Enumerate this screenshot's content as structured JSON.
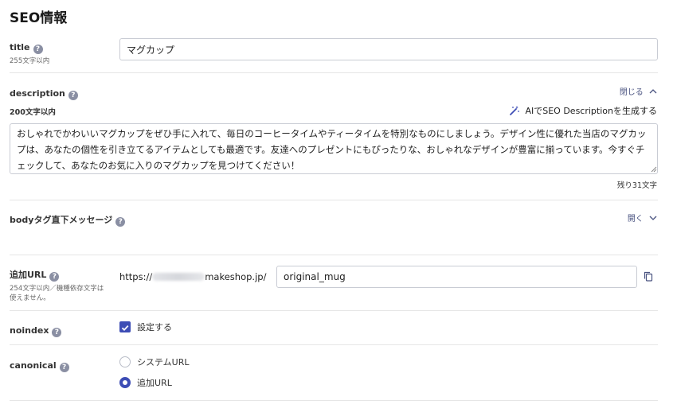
{
  "page": {
    "title": "SEO情報"
  },
  "title_field": {
    "label": "title",
    "limit": "255文字以内",
    "value": "マグカップ"
  },
  "description": {
    "label": "description",
    "toggle": "閉じる",
    "limit": "200文字以内",
    "ai_link": "AIでSEO Descriptionを生成する",
    "value": "おしゃれでかわいいマグカップをぜひ手に入れて、毎日のコーヒータイムやティータイムを特別なものにしましょう。デザイン性に優れた当店のマグカップは、あなたの個性を引き立てるアイテムとしても最適です。友達へのプレゼントにもぴったりな、おしゃれなデザインが豊富に揃っています。今すぐチェックして、あなたのお気に入りのマグカップを見つけてください！",
    "remaining": "残り31文字"
  },
  "body_message": {
    "label": "bodyタグ直下メッセージ",
    "toggle": "開く"
  },
  "additional_url": {
    "label": "追加URL",
    "note_line1": "254文字以内／機種依存文字は",
    "note_line2": "使えません。",
    "prefix_start": "https://",
    "prefix_end": "makeshop.jp/",
    "value": "original_mug"
  },
  "noindex": {
    "label": "noindex",
    "option": "設定する",
    "checked": true
  },
  "canonical": {
    "label": "canonical",
    "options": [
      "システムURL",
      "追加URL"
    ],
    "selected": 1
  },
  "icons": {
    "help": "?",
    "wand": "magic-wand-icon",
    "copy": "copy-icon"
  },
  "colors": {
    "accent": "#3d4db5",
    "link": "#4a5380"
  }
}
